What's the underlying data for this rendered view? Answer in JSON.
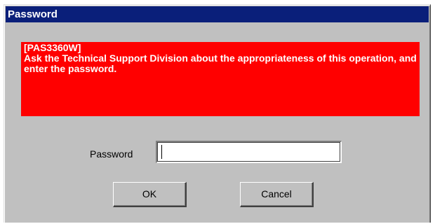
{
  "dialog": {
    "title": "Password",
    "error": {
      "code": "[PAS3360W]",
      "message": "Ask the Technical Support Division about the appropriateness of this operation, and enter the password.",
      "background_color": "#ff0000"
    },
    "password_field": {
      "label": "Password",
      "value": ""
    },
    "buttons": {
      "ok_label": "OK",
      "cancel_label": "Cancel"
    },
    "titlebar_color": "#0a1f7a"
  }
}
